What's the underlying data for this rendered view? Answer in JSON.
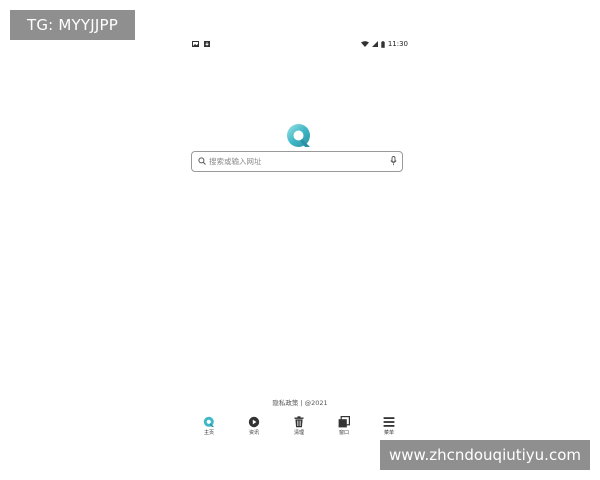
{
  "watermark": {
    "top": "TG: MYYJJPP",
    "bottom": "www.zhcndouqiutiyu.com"
  },
  "status_bar": {
    "time": "11:30",
    "left_icons": [
      "image-icon",
      "download-icon"
    ],
    "right_icons": [
      "wifi-icon",
      "signal-icon",
      "battery-icon"
    ]
  },
  "search": {
    "placeholder": "搜索或输入网址"
  },
  "footer": {
    "privacy": "隐私政策 | @2021"
  },
  "bottom_nav": {
    "items": [
      {
        "label": "主页",
        "icon": "home-logo-icon"
      },
      {
        "label": "资讯",
        "icon": "play-icon"
      },
      {
        "label": "清理",
        "icon": "trash-icon"
      },
      {
        "label": "窗口",
        "icon": "windows-icon"
      },
      {
        "label": "菜单",
        "icon": "menu-icon"
      }
    ]
  },
  "colors": {
    "accent": "#3fb8c7",
    "accent_dark": "#2a8fa0",
    "watermark_bg": "#8f8f8f"
  }
}
